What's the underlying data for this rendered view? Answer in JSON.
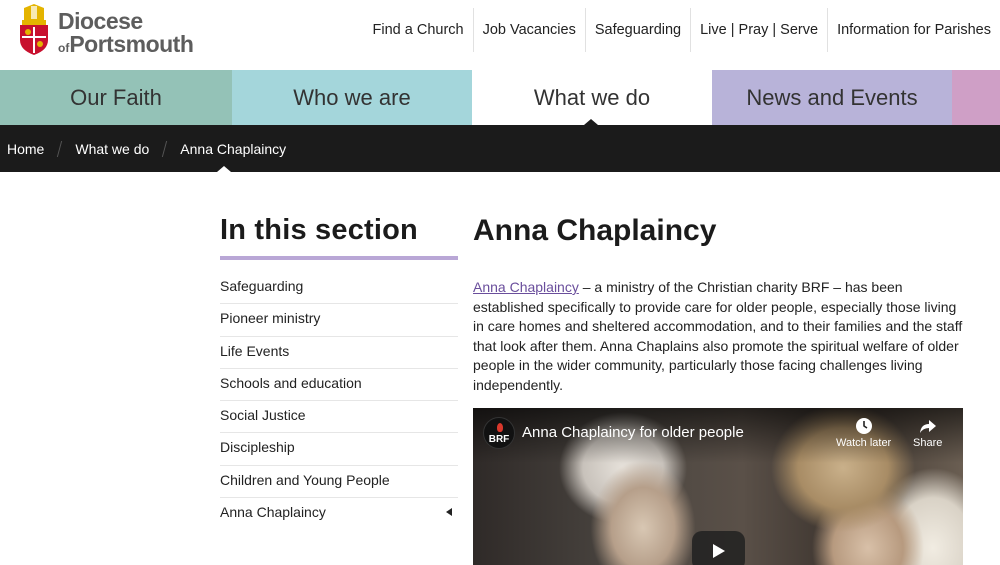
{
  "logo": {
    "line1": "Diocese",
    "of": "of",
    "line2": "Portsmouth"
  },
  "toplinks": [
    "Find a Church",
    "Job Vacancies",
    "Safeguarding",
    "Live | Pray | Serve",
    "Information for Parishes"
  ],
  "mainnav": [
    {
      "label": "Our Faith",
      "color": "#94c2b7"
    },
    {
      "label": "Who we are",
      "color": "#a4d6db"
    },
    {
      "label": "What we do",
      "color": "#ffffff",
      "active": true
    },
    {
      "label": "News and Events",
      "color": "#b8b3d9"
    },
    {
      "label": "",
      "color": "#cf9fc6"
    }
  ],
  "breadcrumb": [
    "Home",
    "What we do",
    "Anna Chaplaincy"
  ],
  "sidebar": {
    "title": "In this section",
    "items": [
      "Safeguarding",
      "Pioneer ministry",
      "Life Events",
      "Schools and education",
      "Social Justice",
      "Discipleship",
      "Children and Young People",
      "Anna Chaplaincy"
    ]
  },
  "content": {
    "title": "Anna Chaplaincy",
    "link_text": "Anna Chaplaincy",
    "intro_rest": " – a ministry of the Christian charity BRF – has been established specifically to provide care for older people, especially those living in care homes and sheltered accommodation, and to their families and the staff that look after them. Anna Chaplains also promote the spiritual welfare of older people in the wider community, particularly those facing challenges living independently."
  },
  "video": {
    "channel": "BRF",
    "title": "Anna Chaplaincy for older people",
    "watch_later": "Watch later",
    "share": "Share"
  },
  "colors": {
    "accent_underline": "#b9a7d6",
    "link": "#6a4e9c",
    "breadcrumb_bg": "#1b1b1b"
  }
}
